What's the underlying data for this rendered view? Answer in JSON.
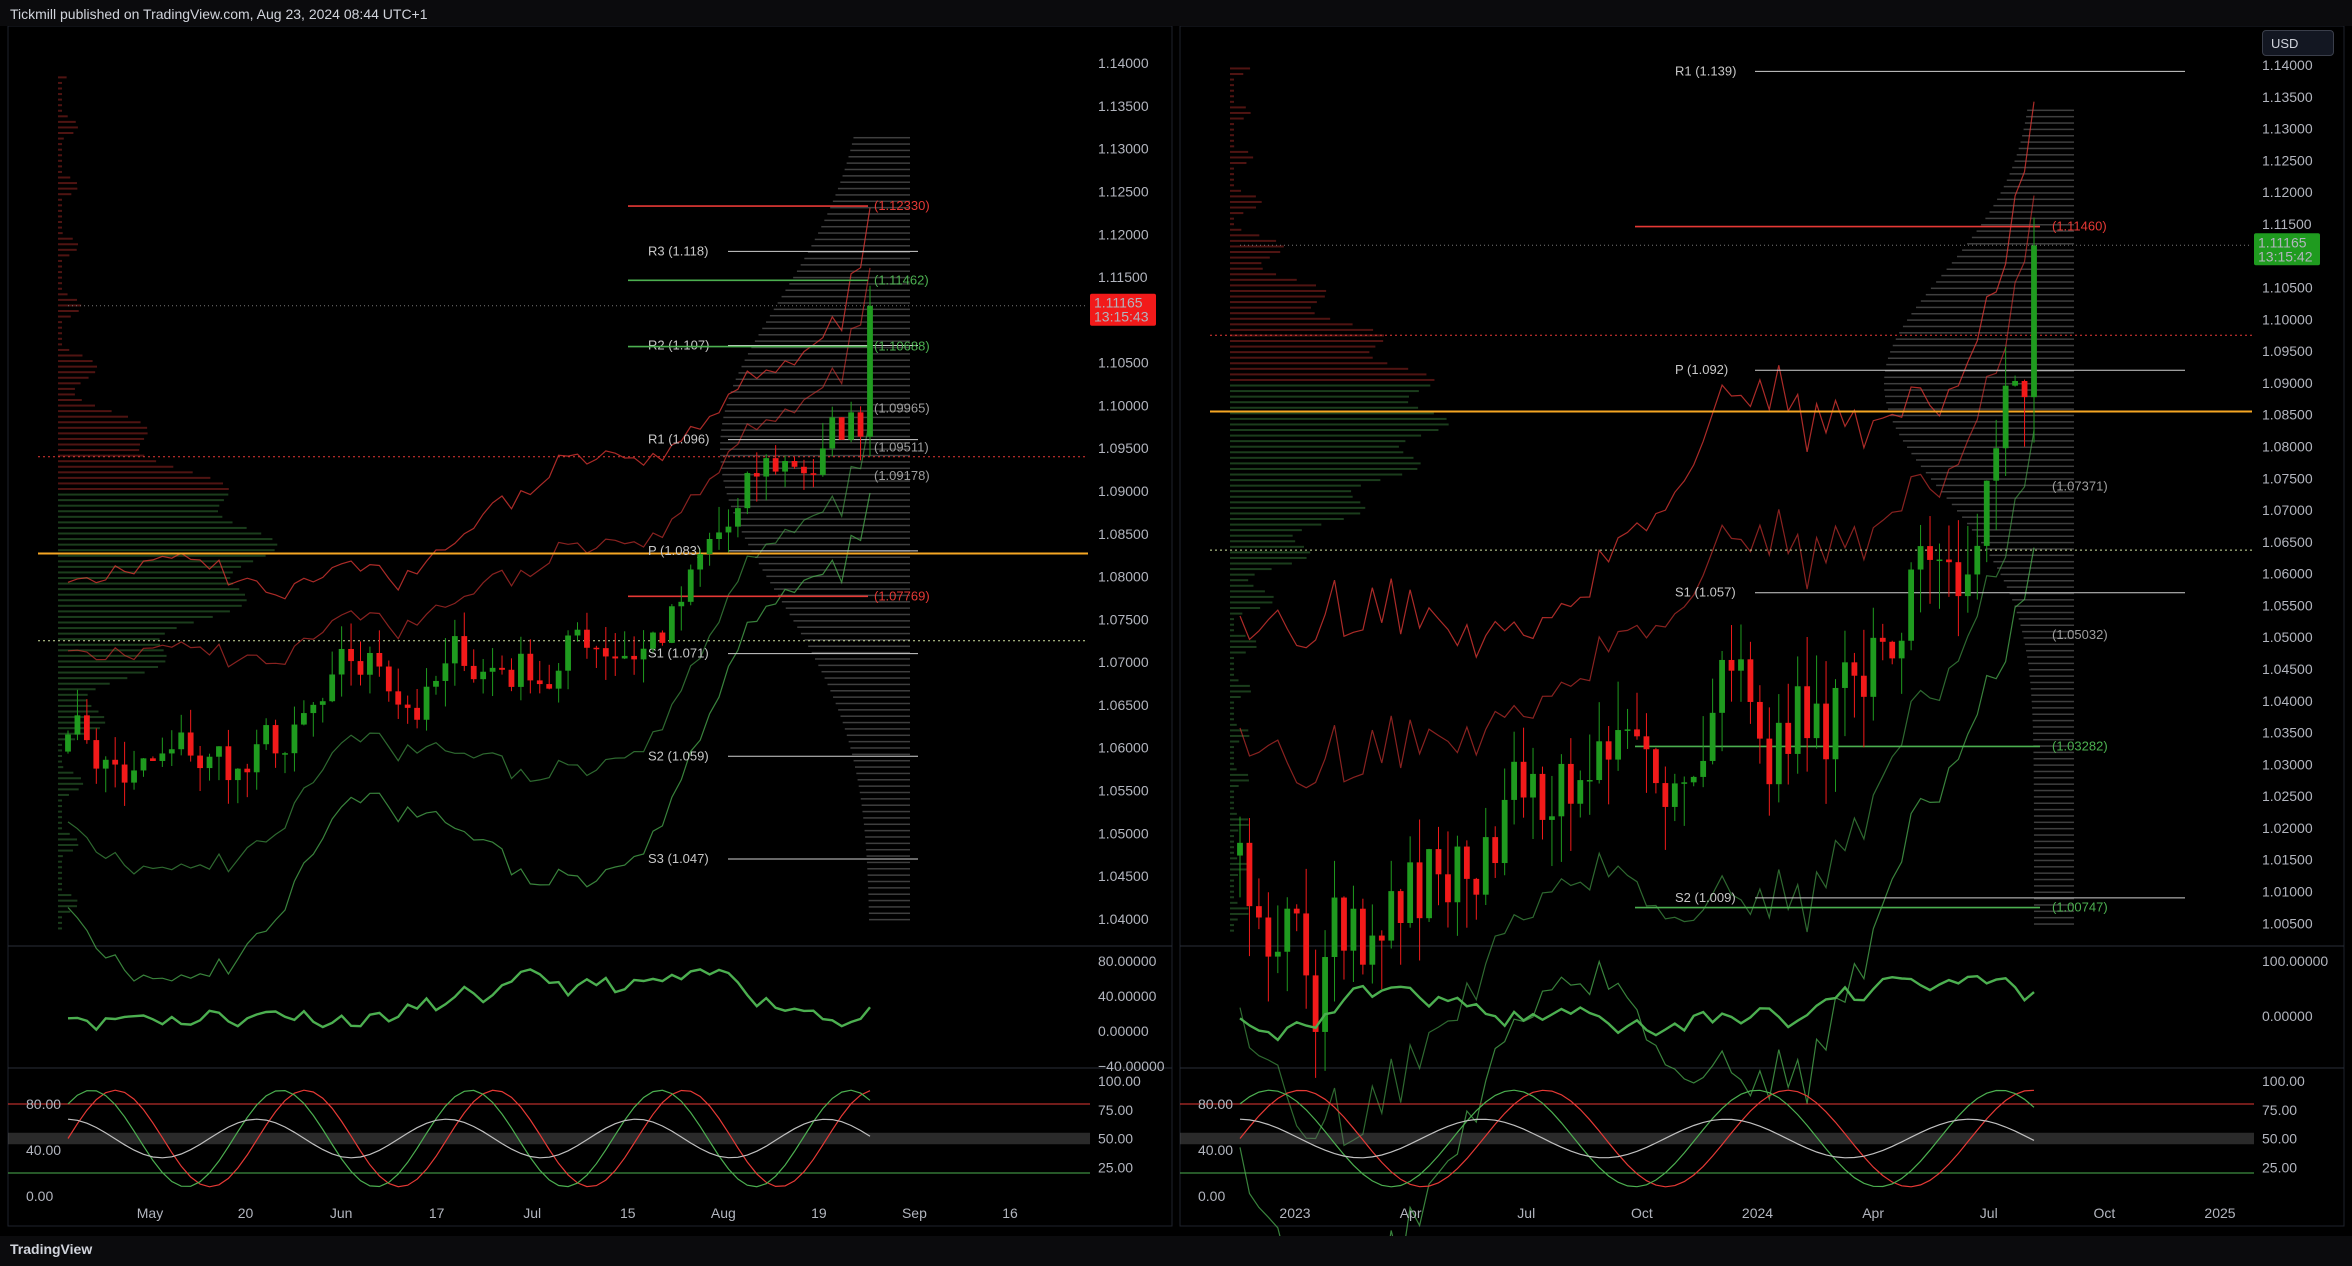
{
  "header": {
    "publisher_text": "Tickmill published on TradingView.com, Aug 23, 2024 08:44 UTC+1"
  },
  "footer": {
    "brand": "TradingView"
  },
  "currency_button": "USD",
  "colors": {
    "up": "#1f9b1f",
    "down": "#f21a1a",
    "bg": "#000000",
    "poc": "#f5a623",
    "line_green": "#4caf50",
    "line_red": "#e53935"
  },
  "chart_data": [
    {
      "type": "candlestick",
      "panel": "left",
      "timeframe": "daily",
      "x_ticks": [
        "May",
        "20",
        "Jun",
        "17",
        "Jul",
        "15",
        "Aug",
        "19",
        "Sep",
        "16"
      ],
      "y_ticks": [
        "1.14000",
        "1.13500",
        "1.13000",
        "1.12500",
        "1.12000",
        "1.11500",
        "1.11000",
        "1.10500",
        "1.10000",
        "1.09500",
        "1.09000",
        "1.08500",
        "1.08000",
        "1.07500",
        "1.07000",
        "1.06500",
        "1.06000",
        "1.05500",
        "1.05000",
        "1.04500",
        "1.04000"
      ],
      "ylim": [
        1.038,
        1.142
      ],
      "last_price": {
        "value": "1.11165",
        "countdown": "13:15:43"
      },
      "pivot_levels": [
        {
          "label": "R3 (1.118)",
          "value": 1.118
        },
        {
          "label": "R2 (1.107)",
          "value": 1.107
        },
        {
          "label": "R1 (1.096)",
          "value": 1.096
        },
        {
          "label": "P (1.083)",
          "value": 1.083
        },
        {
          "label": "S1 (1.071)",
          "value": 1.071
        },
        {
          "label": "S2 (1.059)",
          "value": 1.059
        },
        {
          "label": "S3 (1.047)",
          "value": 1.047
        }
      ],
      "price_labels": [
        {
          "label": "(1.12330)",
          "value": 1.1233,
          "color": "#e53935"
        },
        {
          "label": "(1.11462)",
          "value": 1.11462,
          "color": "#4caf50"
        },
        {
          "label": "(1.10688)",
          "value": 1.10688,
          "color": "#4caf50"
        },
        {
          "label": "(1.09965)",
          "value": 1.09965,
          "color": "#9e9e9e"
        },
        {
          "label": "(1.09511)",
          "value": 1.09511,
          "color": "#9e9e9e"
        },
        {
          "label": "(1.09178)",
          "value": 1.09178,
          "color": "#9e9e9e"
        },
        {
          "label": "(1.07769)",
          "value": 1.07769,
          "color": "#e53935"
        }
      ],
      "rsi_ticks": [
        "80.00000",
        "40.00000",
        "0.00000",
        "−40.00000"
      ],
      "stoch_ticks_left": [
        "80.00",
        "40.00",
        "0.00"
      ],
      "stoch_ticks_right": [
        "100.00",
        "75.00",
        "50.00",
        "25.00"
      ]
    },
    {
      "type": "candlestick",
      "panel": "right",
      "timeframe": "weekly",
      "x_ticks": [
        "2023",
        "Apr",
        "Jul",
        "Oct",
        "2024",
        "Apr",
        "Jul",
        "Oct",
        "2025"
      ],
      "y_ticks": [
        "1.14000",
        "1.13500",
        "1.13000",
        "1.12500",
        "1.12000",
        "1.11500",
        "1.11000",
        "1.10500",
        "1.10000",
        "1.09500",
        "1.09000",
        "1.08500",
        "1.08000",
        "1.07500",
        "1.07000",
        "1.06500",
        "1.06000",
        "1.05500",
        "1.05000",
        "1.04500",
        "1.04000",
        "1.03500",
        "1.03000",
        "1.02500",
        "1.02000",
        "1.01500",
        "1.01000",
        "1.00500"
      ],
      "ylim": [
        1.003,
        1.143
      ],
      "last_price": {
        "value": "1.11165",
        "countdown": "13:15:42"
      },
      "pivot_levels": [
        {
          "label": "R1 (1.139)",
          "value": 1.139
        },
        {
          "label": "P (1.092)",
          "value": 1.092
        },
        {
          "label": "S1 (1.057)",
          "value": 1.057
        },
        {
          "label": "S2 (1.009)",
          "value": 1.009
        }
      ],
      "price_labels": [
        {
          "label": "(1.11460)",
          "value": 1.1146,
          "color": "#e53935"
        },
        {
          "label": "(1.07371)",
          "value": 1.07371,
          "color": "#9e9e9e"
        },
        {
          "label": "(1.05032)",
          "value": 1.05032,
          "color": "#9e9e9e"
        },
        {
          "label": "(1.03282)",
          "value": 1.03282,
          "color": "#4caf50"
        },
        {
          "label": "(1.00747)",
          "value": 1.00747,
          "color": "#4caf50"
        }
      ],
      "rsi_ticks": [
        "100.00000",
        "0.00000"
      ],
      "stoch_ticks_left": [
        "80.00",
        "40.00",
        "0.00"
      ],
      "stoch_ticks_right": [
        "100.00",
        "75.00",
        "50.00",
        "25.00"
      ]
    }
  ]
}
